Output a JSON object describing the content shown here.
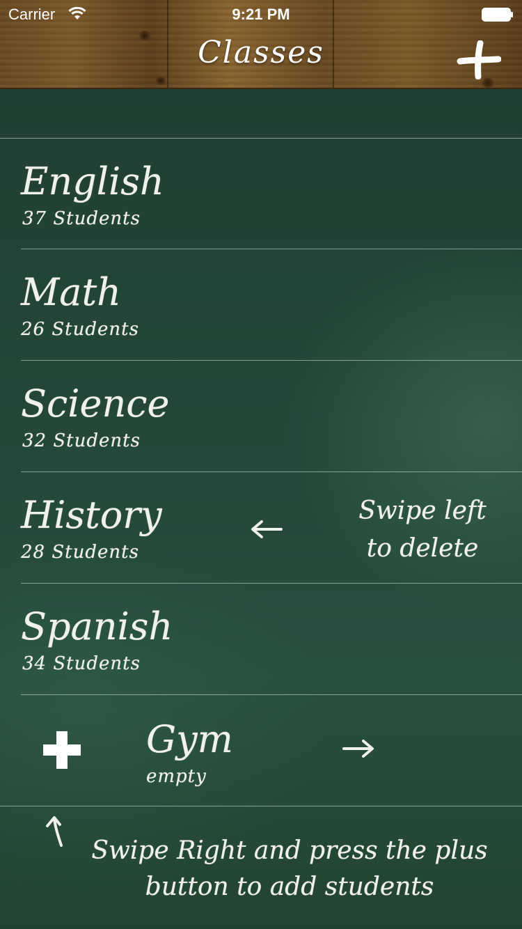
{
  "status_bar": {
    "carrier": "Carrier",
    "time": "9:21 PM"
  },
  "nav": {
    "title": "Classes",
    "add_icon": "plus-icon"
  },
  "classes": [
    {
      "name": "English",
      "count": "37 Students"
    },
    {
      "name": "Math",
      "count": "26 Students"
    },
    {
      "name": "Science",
      "count": "32 Students"
    },
    {
      "name": "History",
      "count": "28 Students"
    },
    {
      "name": "Spanish",
      "count": "34 Students"
    }
  ],
  "swiped_row": {
    "name": "Gym",
    "count": "empty",
    "action_icon": "plus-icon"
  },
  "hints": {
    "delete_line1": "Swipe left",
    "delete_line2": "to delete",
    "add_line1": "Swipe Right and press the plus",
    "add_line2": "button to add students"
  },
  "colors": {
    "board": "#244839",
    "wood": "#6b4a22",
    "chalk": "#f1f1ec"
  }
}
